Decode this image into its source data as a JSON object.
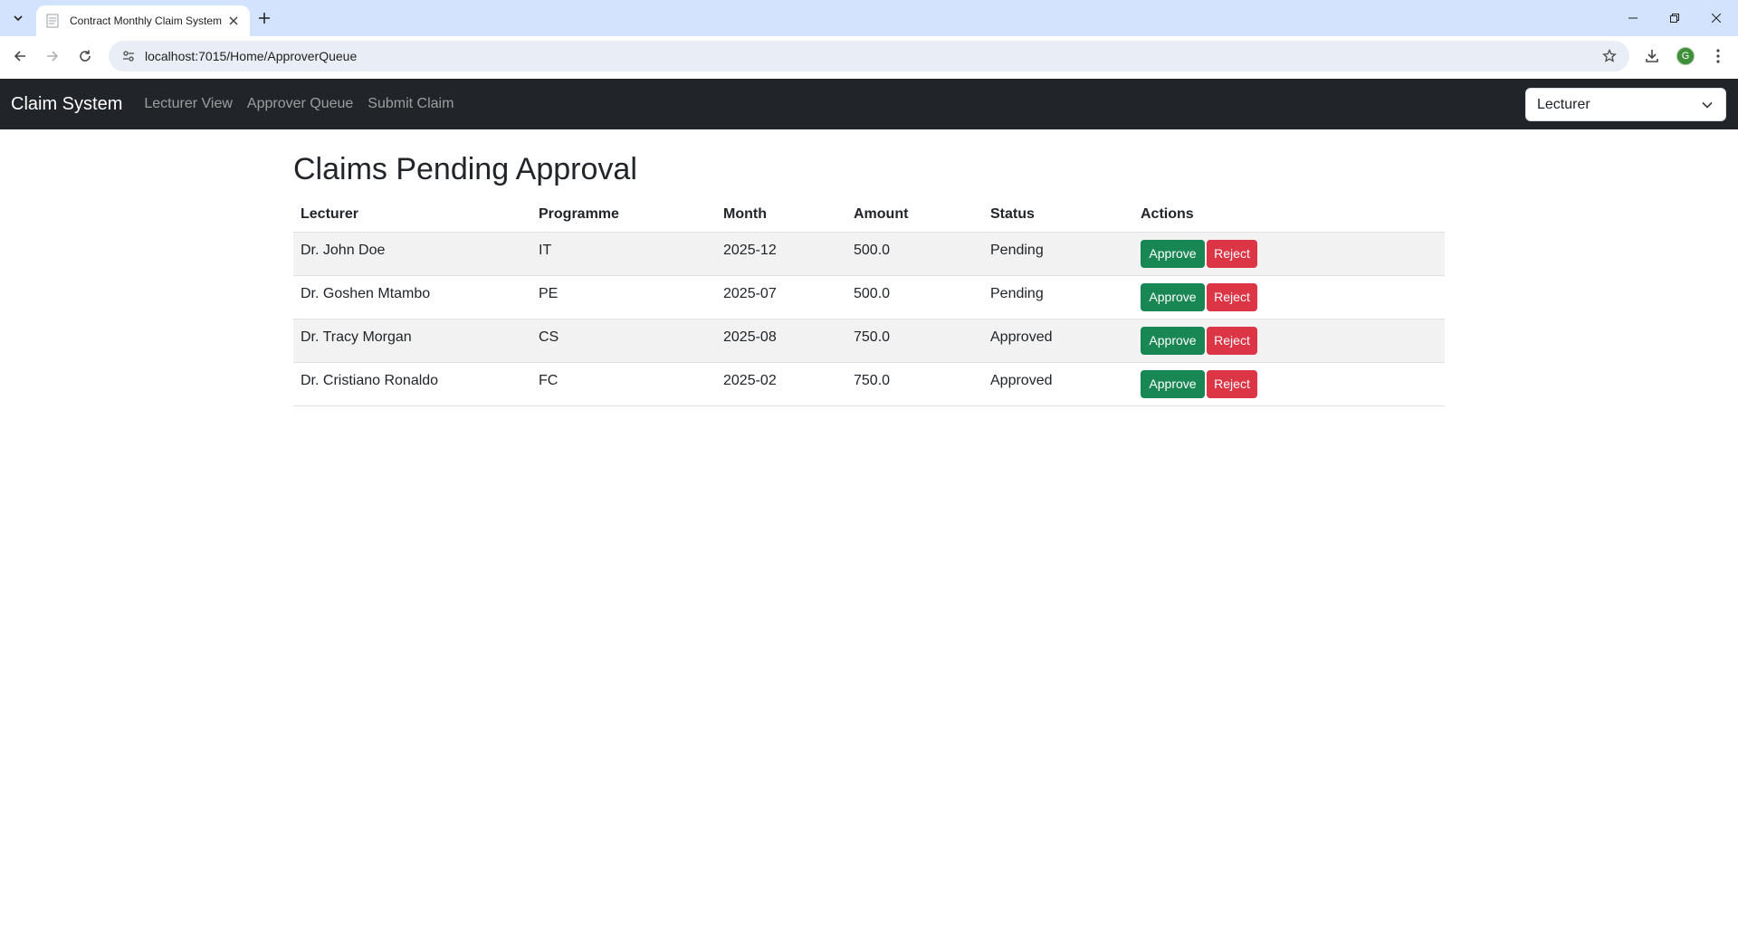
{
  "browser": {
    "tab_title": "Contract Monthly Claim System",
    "url": "localhost:7015/Home/ApproverQueue",
    "profile_initial": "G"
  },
  "navbar": {
    "brand": "Claim System",
    "links": [
      "Lecturer View",
      "Approver Queue",
      "Submit Claim"
    ],
    "role_selected": "Lecturer"
  },
  "page": {
    "title": "Claims Pending Approval",
    "columns": [
      "Lecturer",
      "Programme",
      "Month",
      "Amount",
      "Status",
      "Actions"
    ],
    "rows": [
      {
        "lecturer": "Dr. John Doe",
        "programme": "IT",
        "month": "2025-12",
        "amount": "500.0",
        "status": "Pending"
      },
      {
        "lecturer": "Dr. Goshen Mtambo",
        "programme": "PE",
        "month": "2025-07",
        "amount": "500.0",
        "status": "Pending"
      },
      {
        "lecturer": "Dr. Tracy Morgan",
        "programme": "CS",
        "month": "2025-08",
        "amount": "750.0",
        "status": "Approved"
      },
      {
        "lecturer": "Dr. Cristiano Ronaldo",
        "programme": "FC",
        "month": "2025-02",
        "amount": "750.0",
        "status": "Approved"
      }
    ],
    "approve_label": "Approve",
    "reject_label": "Reject"
  },
  "colors": {
    "navbar_bg": "#212529",
    "approve": "#198754",
    "reject": "#dc3545",
    "tabstrip_bg": "#d3e3fd"
  }
}
